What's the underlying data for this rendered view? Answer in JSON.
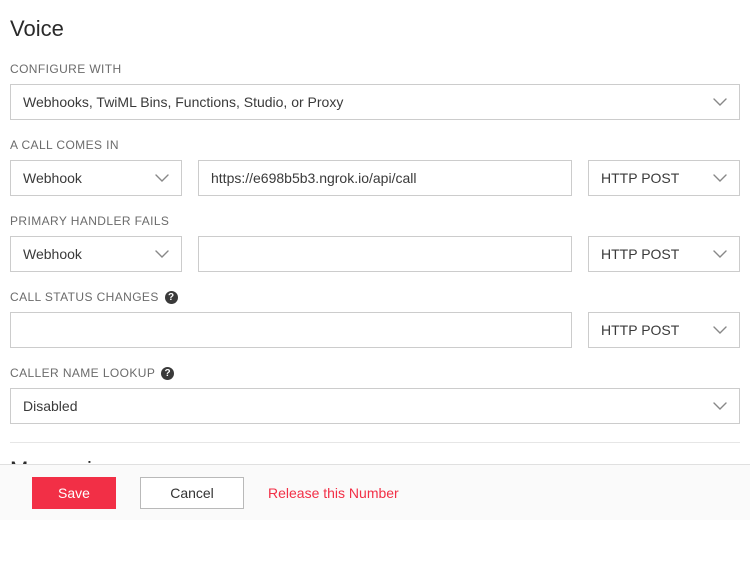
{
  "sections": {
    "voice_title": "Voice",
    "messaging_title": "Messaging"
  },
  "configure_with": {
    "label": "CONFIGURE WITH",
    "value": "Webhooks, TwiML Bins, Functions, Studio, or Proxy"
  },
  "call_comes_in": {
    "label": "A CALL COMES IN",
    "type_value": "Webhook",
    "url_value": "https://e698b5b3.ngrok.io/api/call",
    "method_value": "HTTP POST"
  },
  "primary_fails": {
    "label": "PRIMARY HANDLER FAILS",
    "type_value": "Webhook",
    "url_value": "",
    "method_value": "HTTP POST"
  },
  "call_status": {
    "label": "CALL STATUS CHANGES",
    "url_value": "",
    "method_value": "HTTP POST"
  },
  "caller_lookup": {
    "label": "CALLER NAME LOOKUP",
    "value": "Disabled"
  },
  "footer": {
    "save": "Save",
    "cancel": "Cancel",
    "release": "Release this Number"
  }
}
